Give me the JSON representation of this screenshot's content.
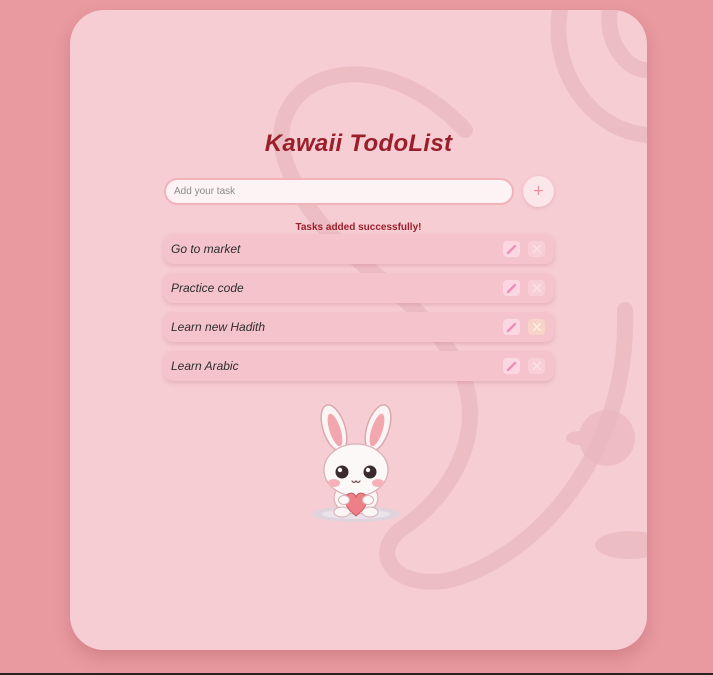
{
  "app": {
    "title": "Kawaii TodoList"
  },
  "input": {
    "placeholder": "Add your task",
    "value": "",
    "add_label": "+"
  },
  "status": {
    "message": "Tasks added successfully!"
  },
  "tasks": [
    {
      "text": "Go to market"
    },
    {
      "text": "Practice code"
    },
    {
      "text": "Learn new Hadith"
    },
    {
      "text": "Learn Arabic"
    }
  ],
  "icons": {
    "edit": "pencil-icon",
    "delete": "close-icon",
    "mascot": "bunny-heart-icon"
  },
  "colors": {
    "background": "#e89aa0",
    "card": "#f6cdd3",
    "accent": "#9b1f2b",
    "task": "#f4c3cb"
  }
}
